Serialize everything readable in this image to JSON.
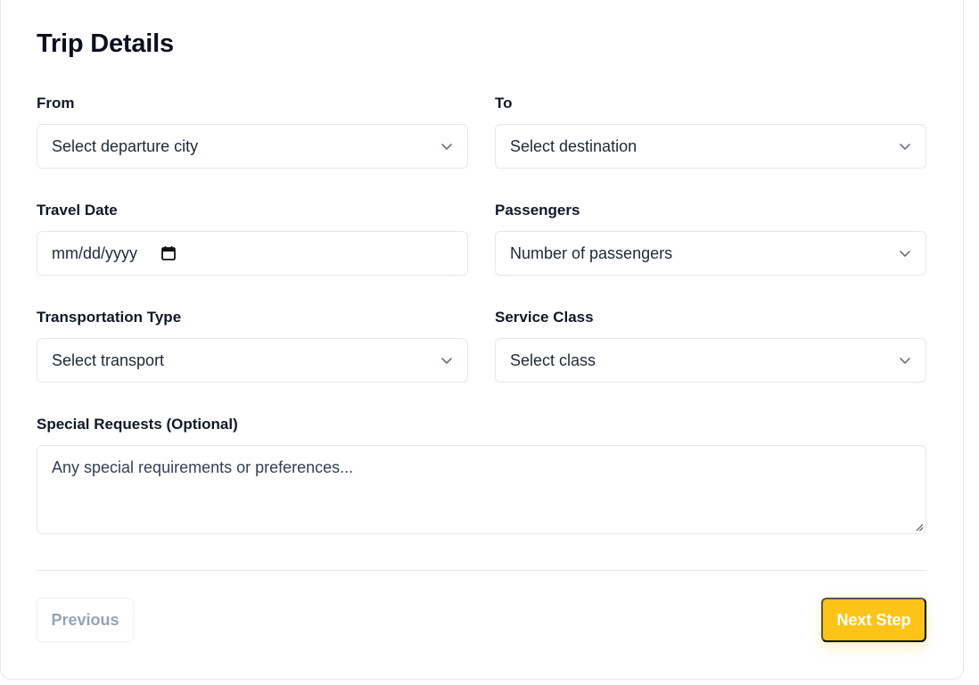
{
  "form": {
    "title": "Trip Details",
    "from": {
      "label": "From",
      "value": "Select departure city"
    },
    "to": {
      "label": "To",
      "value": "Select destination"
    },
    "travel_date": {
      "label": "Travel Date",
      "value": "mm/dd/yyyy"
    },
    "passengers": {
      "label": "Passengers",
      "value": "Number of passengers"
    },
    "transport": {
      "label": "Transportation Type",
      "value": "Select transport"
    },
    "service_class": {
      "label": "Service Class",
      "value": "Select class"
    },
    "special_requests": {
      "label": "Special Requests (Optional)",
      "placeholder": "Any special requirements or preferences..."
    }
  },
  "actions": {
    "previous_label": "Previous",
    "next_label": "Next Step"
  },
  "colors": {
    "accent": "#fcc419",
    "border": "#e2e8f0",
    "disabled_text": "#94a3b8"
  },
  "icons": {
    "dropdown": "chevron-down-icon",
    "date": "calendar-icon",
    "resize": "resize-handle-icon"
  }
}
